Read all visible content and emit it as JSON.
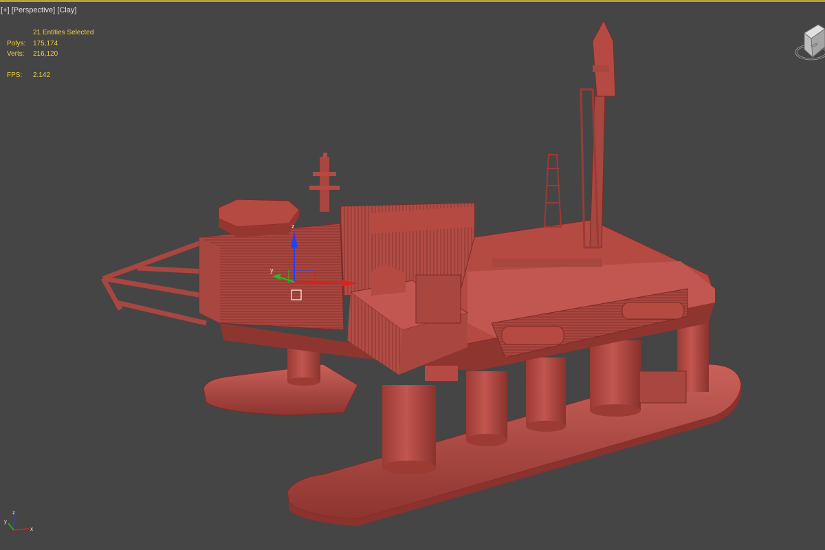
{
  "viewport": {
    "labels": {
      "plus": "[+]",
      "view": "[Perspective]",
      "shading": "[Clay]"
    },
    "stats": {
      "selection": "21 Entities Selected",
      "polys_label": "Polys:",
      "polys_value": "175,174",
      "verts_label": "Verts:",
      "verts_value": "216,120",
      "fps_label": "FPS:",
      "fps_value": "2.142"
    },
    "viewcube": {
      "face_label": "TOP"
    },
    "axis_tripod": {
      "x": "x",
      "y": "y",
      "z": "z"
    },
    "gizmo": {
      "x": "x",
      "y": "y",
      "z": "z"
    }
  },
  "colors": {
    "background": "#454545",
    "model": "#b54a43",
    "model_dark": "#8a322d",
    "model_light": "#c9615a",
    "stats_text": "#f2d13c",
    "active_border": "#b8a036",
    "axis_x": "#e0201a",
    "axis_y": "#20c020",
    "axis_z": "#2040ff"
  }
}
